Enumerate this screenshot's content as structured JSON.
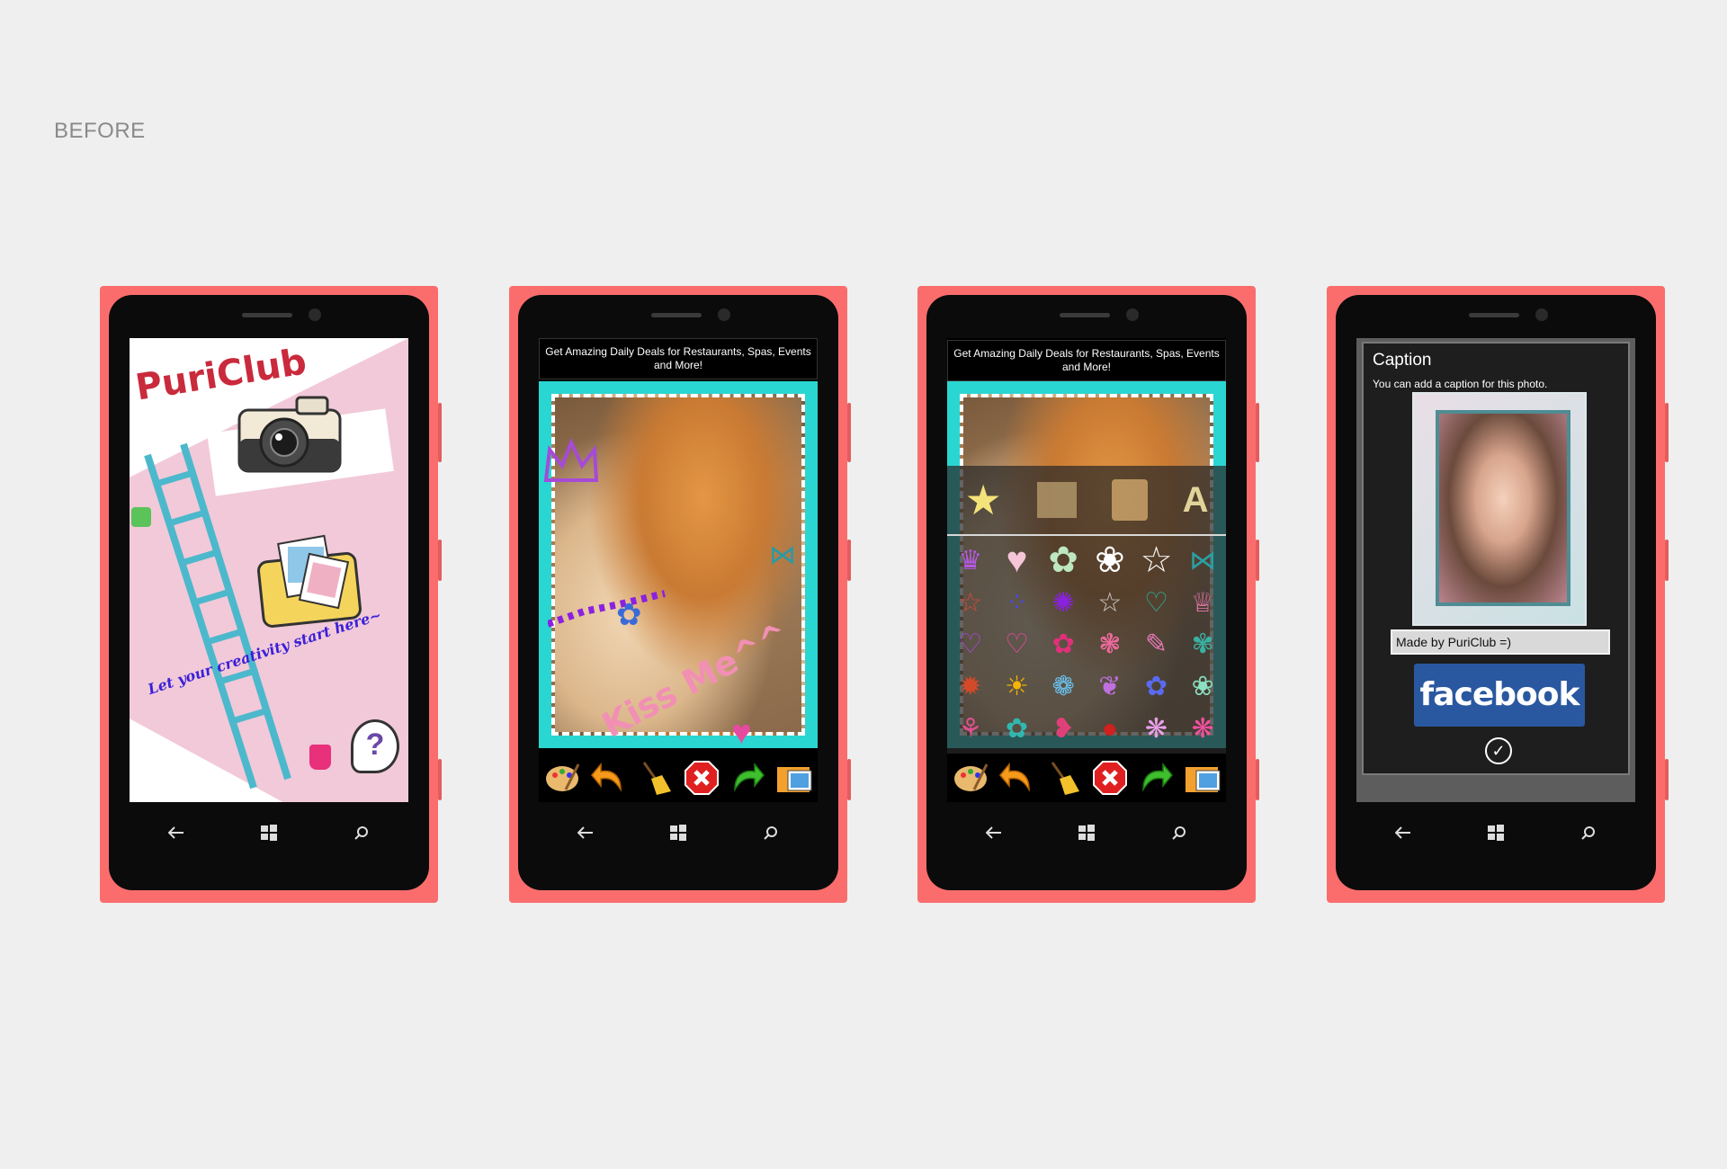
{
  "heading": "BEFORE",
  "nav": {
    "back_icon": "back-arrow-icon",
    "windows_icon": "windows-logo-icon",
    "search_icon": "search-icon"
  },
  "colors": {
    "phone_body": "#fb6d6d",
    "frame_cyan": "#2ad6d2",
    "facebook_blue": "#2a58a0"
  },
  "screen1": {
    "app_name": "PuriClub",
    "tagline": "Let your creativity start here~"
  },
  "ad": {
    "text": "Get Amazing Daily Deals for Restaurants, Spas, Events and More!"
  },
  "screen2": {
    "sticker_text": "Kiss Me^^",
    "toolbar": [
      "palette-icon",
      "undo-icon",
      "broom-icon",
      "delete-icon",
      "redo-icon",
      "save-folder-icon"
    ]
  },
  "screen3": {
    "sticker_tabs": [
      "star-face-icon",
      "cards-icon",
      "pencil-cup-icon",
      "letters-icon"
    ],
    "stickers": [
      "crown",
      "heart",
      "flower",
      "flower-outline",
      "star-outline",
      "ribbon",
      "star-small",
      "dots",
      "splash",
      "star-outline-small",
      "heart-outline",
      "crown-outline",
      "heart-outline",
      "heart-outline-2",
      "flower-pink",
      "blossom",
      "text-sticker",
      "flower-teal",
      "firework",
      "sun",
      "daisy",
      "bouquet",
      "blue-flower",
      "teal-flower",
      "lollipop",
      "teal-flower-2",
      "pink-bird",
      "ladybug",
      "butterfly",
      "pink-butterfly"
    ]
  },
  "screen4": {
    "dialog_title": "Caption",
    "dialog_subtitle": "You can add a caption for this photo.",
    "caption_value": "Made by PuriClub =)",
    "share_label": "facebook",
    "confirm_icon": "checkmark-circle-icon"
  }
}
